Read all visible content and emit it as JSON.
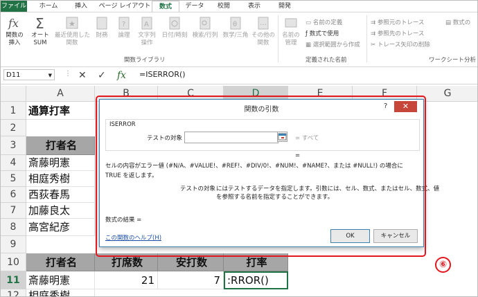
{
  "ribbon_tabs": [
    "ファイル",
    "ホーム",
    "挿入",
    "ページ レイアウト",
    "数式",
    "データ",
    "校閲",
    "表示",
    "開発"
  ],
  "ribbon": {
    "insert_function": "関数の\n挿入",
    "autosum": "オート\nSUM",
    "recent": "最近使用した\n関数",
    "financial": "財務",
    "logical": "論理",
    "text": "文字列\n操作",
    "datetime": "日付/時刻",
    "lookup": "検索/行列",
    "math": "数学/三角",
    "more": "その他の\n関数",
    "library_label": "関数ライブラリ",
    "name_manager": "名前の\n管理",
    "define_name": "名前の定義",
    "use_in_formula": "数式で使用",
    "create_from_selection": "選択範囲から作成",
    "defined_names_label": "定義された名前",
    "trace_precedents": "参照元のトレース",
    "trace_dependents": "参照先のトレース",
    "remove_arrows": "トレース矢印の削除",
    "show_formulas": "数式の",
    "auditing_label": "ワークシート分析"
  },
  "formula_bar": {
    "name_box": "D11",
    "formula": "=ISERROR()",
    "cancel_glyph": "✕",
    "enter_glyph": "✓",
    "fx_glyph": "fx"
  },
  "columns": [
    "A",
    "B",
    "C",
    "D",
    "E",
    "F",
    "G"
  ],
  "rows": [
    "1",
    "2",
    "3",
    "4",
    "5",
    "6",
    "7",
    "8",
    "9",
    "10",
    "11",
    "12"
  ],
  "cells": {
    "A1": "通算打率",
    "A3": "打者名",
    "A4": "斎藤明憲",
    "A5": "相庭秀樹",
    "A6": "西荻春馬",
    "A7": "加藤良太",
    "A8": "高宮紀彦",
    "A10": "打者名",
    "B10": "打席数",
    "C10": "安打数",
    "D10": "打率",
    "A11": "斎藤明憲",
    "B11": "21",
    "C11": "7",
    "D11": ":RROR()",
    "A12": "相庭秀樹"
  },
  "dialog": {
    "title": "関数の引数",
    "help_glyph": "?",
    "close_glyph": "✕",
    "function_name": "ISERROR",
    "arg_label": "テストの対象",
    "arg_value": "",
    "arg_result": "= すべて",
    "eq_result": "=",
    "description": "セルの内容がエラー値 (#N/A、#VALUE!、#REF!、#DIV/0!、#NUM!、#NAME?、または #NULL!) の場合に TRUE を返します。",
    "arg_desc_label": "テストの対象",
    "arg_desc_line1": "にはテストするデータを指定します。引数には、セル、数式、またはセル、数式、値",
    "arg_desc_line2": "を参照する名前を指定することができます。",
    "result_label": "数式の結果 =",
    "help_link": "この関数のヘルプ(H)",
    "ok": "OK",
    "cancel": "キャンセル"
  },
  "annotation_marker": "⑥",
  "colors": {
    "excel_green": "#217346",
    "highlight_red": "#e2161d",
    "header_grey": "#a6a6a6"
  }
}
